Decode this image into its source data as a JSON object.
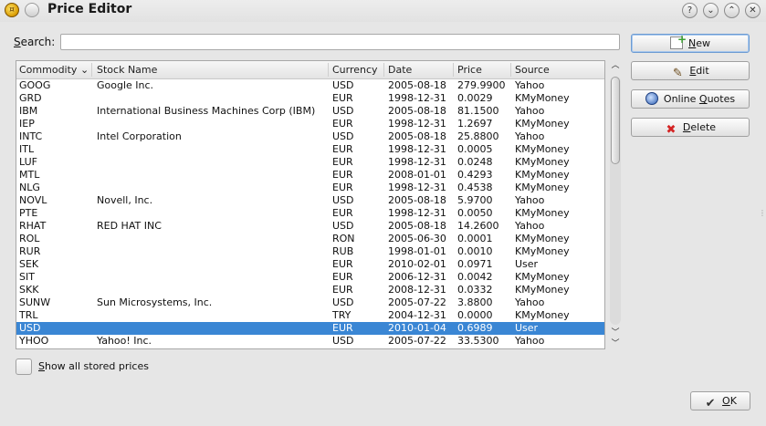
{
  "window": {
    "title": "Price Editor",
    "buttons": {
      "help": "?",
      "minimize": "⌄",
      "maximize": "⌃",
      "close": "✕"
    }
  },
  "search": {
    "label_mnemonic": "S",
    "label_rest": "earch:",
    "value": "",
    "placeholder": ""
  },
  "table": {
    "columns": [
      "Commodity",
      "Stock Name",
      "Currency",
      "Date",
      "Price",
      "Source"
    ],
    "sort_indicator": "⌄",
    "rows": [
      {
        "commodity": "GOOG",
        "name": "Google Inc.",
        "currency": "USD",
        "date": "2005-08-18",
        "price": "279.9900",
        "source": "Yahoo"
      },
      {
        "commodity": "GRD",
        "name": "",
        "currency": "EUR",
        "date": "1998-12-31",
        "price": "0.0029",
        "source": "KMyMoney"
      },
      {
        "commodity": "IBM",
        "name": "International Business Machines Corp (IBM)",
        "currency": "USD",
        "date": "2005-08-18",
        "price": "81.1500",
        "source": "Yahoo"
      },
      {
        "commodity": "IEP",
        "name": "",
        "currency": "EUR",
        "date": "1998-12-31",
        "price": "1.2697",
        "source": "KMyMoney"
      },
      {
        "commodity": "INTC",
        "name": "Intel Corporation",
        "currency": "USD",
        "date": "2005-08-18",
        "price": "25.8800",
        "source": "Yahoo"
      },
      {
        "commodity": "ITL",
        "name": "",
        "currency": "EUR",
        "date": "1998-12-31",
        "price": "0.0005",
        "source": "KMyMoney"
      },
      {
        "commodity": "LUF",
        "name": "",
        "currency": "EUR",
        "date": "1998-12-31",
        "price": "0.0248",
        "source": "KMyMoney"
      },
      {
        "commodity": "MTL",
        "name": "",
        "currency": "EUR",
        "date": "2008-01-01",
        "price": "0.4293",
        "source": "KMyMoney"
      },
      {
        "commodity": "NLG",
        "name": "",
        "currency": "EUR",
        "date": "1998-12-31",
        "price": "0.4538",
        "source": "KMyMoney"
      },
      {
        "commodity": "NOVL",
        "name": "Novell, Inc.",
        "currency": "USD",
        "date": "2005-08-18",
        "price": "5.9700",
        "source": "Yahoo"
      },
      {
        "commodity": "PTE",
        "name": "",
        "currency": "EUR",
        "date": "1998-12-31",
        "price": "0.0050",
        "source": "KMyMoney"
      },
      {
        "commodity": "RHAT",
        "name": "RED HAT INC",
        "currency": "USD",
        "date": "2005-08-18",
        "price": "14.2600",
        "source": "Yahoo"
      },
      {
        "commodity": "ROL",
        "name": "",
        "currency": "RON",
        "date": "2005-06-30",
        "price": "0.0001",
        "source": "KMyMoney"
      },
      {
        "commodity": "RUR",
        "name": "",
        "currency": "RUB",
        "date": "1998-01-01",
        "price": "0.0010",
        "source": "KMyMoney"
      },
      {
        "commodity": "SEK",
        "name": "",
        "currency": "EUR",
        "date": "2010-02-01",
        "price": "0.0971",
        "source": "User"
      },
      {
        "commodity": "SIT",
        "name": "",
        "currency": "EUR",
        "date": "2006-12-31",
        "price": "0.0042",
        "source": "KMyMoney"
      },
      {
        "commodity": "SKK",
        "name": "",
        "currency": "EUR",
        "date": "2008-12-31",
        "price": "0.0332",
        "source": "KMyMoney"
      },
      {
        "commodity": "SUNW",
        "name": "Sun Microsystems, Inc.",
        "currency": "USD",
        "date": "2005-07-22",
        "price": "3.8800",
        "source": "Yahoo"
      },
      {
        "commodity": "TRL",
        "name": "",
        "currency": "TRY",
        "date": "2004-12-31",
        "price": "0.0000",
        "source": "KMyMoney"
      },
      {
        "commodity": "USD",
        "name": "",
        "currency": "EUR",
        "date": "2010-01-04",
        "price": "0.6989",
        "source": "User"
      },
      {
        "commodity": "YHOO",
        "name": "Yahoo! Inc.",
        "currency": "USD",
        "date": "2005-07-22",
        "price": "33.5300",
        "source": "Yahoo"
      }
    ]
  },
  "buttons": {
    "new": {
      "mnemonic": "N",
      "rest": "ew"
    },
    "edit": {
      "mnemonic": "E",
      "rest": "dit"
    },
    "online_quotes": {
      "pre": "Online ",
      "mnemonic": "Q",
      "rest": "uotes"
    },
    "delete": {
      "mnemonic": "D",
      "rest": "elete"
    },
    "ok": {
      "mnemonic": "O",
      "rest": "K"
    }
  },
  "show_all": {
    "mnemonic": "S",
    "rest": "how all stored prices",
    "checked": false
  },
  "colors": {
    "selection": "#3a86d4",
    "window_bg": "#e6e6e6",
    "delete_icon": "#d42424"
  },
  "icons": {
    "app": "kmymoney-coin-icon",
    "new": "new-document-icon",
    "edit": "edit-pencil-icon",
    "quotes": "online-quotes-icon",
    "delete": "delete-x-icon",
    "ok": "checkmark-icon"
  }
}
